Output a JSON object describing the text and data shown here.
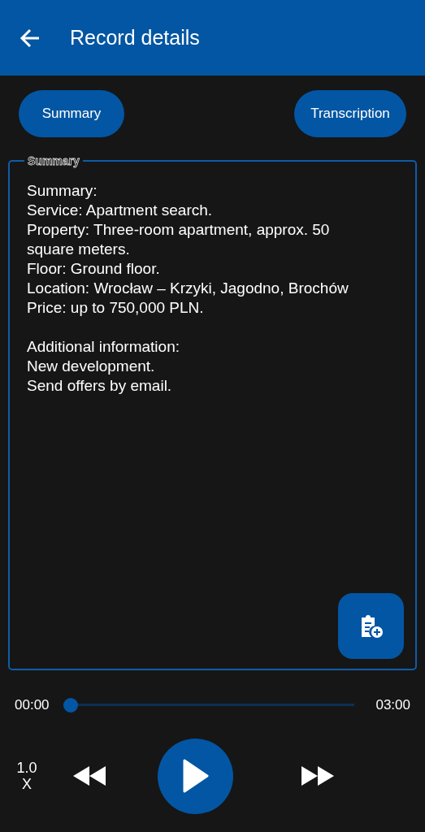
{
  "app_bar": {
    "title": "Record details"
  },
  "tabs": [
    {
      "label": "Summary",
      "selected": false
    },
    {
      "label": "Transcription",
      "selected": false
    }
  ],
  "summary_panel": {
    "legend": "Summary",
    "paragraphs": [
      [
        "Summary:",
        "Service: Apartment search.",
        "Property: Three-room apartment, approx. 50 square meters.",
        "Floor: Ground floor.",
        "Location: Wrocław – Krzyki, Jagodno, Brochów",
        "Price: up to 750,000 PLN."
      ],
      [
        "Additional information:",
        "New development.",
        "Send offers by email."
      ]
    ]
  },
  "player": {
    "elapsed": "00:00",
    "total": "03:00",
    "level": 0,
    "speed": "1.0 X"
  }
}
